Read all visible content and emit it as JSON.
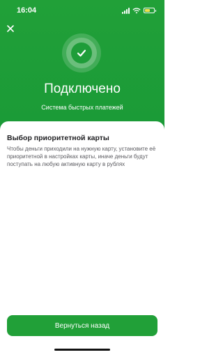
{
  "status_bar": {
    "time": "16:04",
    "icons": [
      "signal-icon",
      "wifi-icon",
      "battery-icon"
    ],
    "battery_color": "#f4e04d"
  },
  "header": {
    "close_icon": "close-icon",
    "status_icon": "checkmark-icon",
    "title": "Подключено",
    "subtitle": "Система быстрых платежей",
    "background": "#21a038"
  },
  "card": {
    "title": "Выбор приоритетной карты",
    "text": "Чтобы деньги приходили на нужную карту, установите её приоритетной в настройках карты, иначе деньги будут поступать на любую активную карту в рублях"
  },
  "actions": {
    "back_label": "Вернуться назад",
    "accent": "#21a038"
  }
}
